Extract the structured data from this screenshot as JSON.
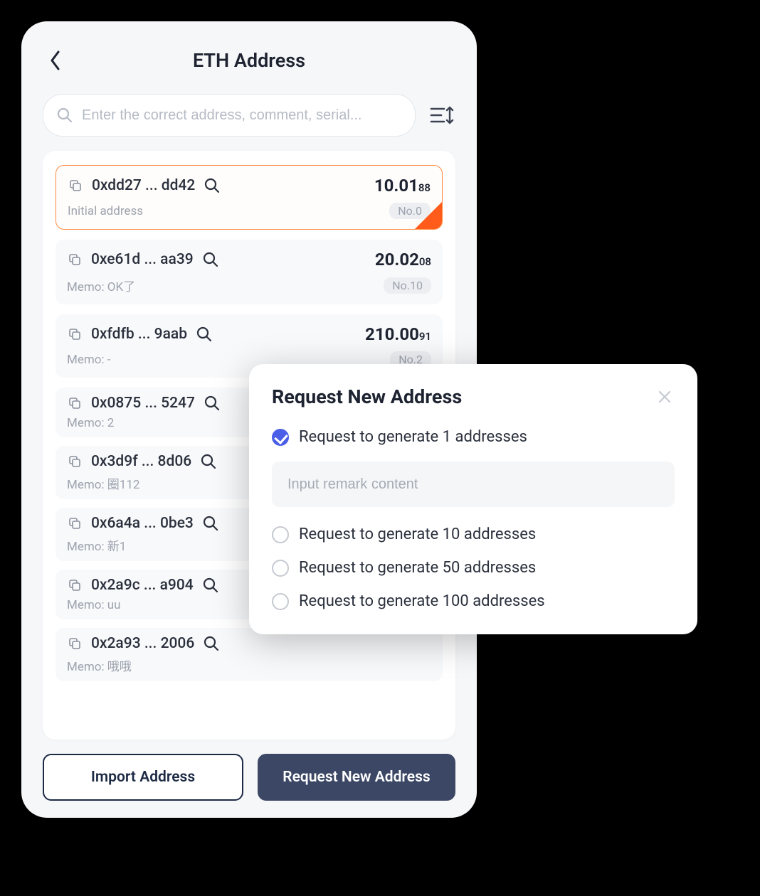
{
  "header": {
    "title": "ETH Address"
  },
  "search": {
    "placeholder": "Enter the correct address, comment, serial..."
  },
  "addresses": [
    {
      "addr": "0xdd27 ... dd42",
      "balance_int": "10.01",
      "balance_dec": "88",
      "memo": "Initial address",
      "no": "No.0",
      "selected": true
    },
    {
      "addr": "0xe61d ... aa39",
      "balance_int": "20.02",
      "balance_dec": "08",
      "memo": "Memo: OK了",
      "no": "No.10",
      "selected": false
    },
    {
      "addr": "0xfdfb ... 9aab",
      "balance_int": "210.00",
      "balance_dec": "91",
      "memo": "Memo: -",
      "no": "No.2",
      "selected": false
    },
    {
      "addr": "0x0875 ... 5247",
      "balance_int": "",
      "balance_dec": "",
      "memo": "Memo: 2",
      "no": "",
      "selected": false
    },
    {
      "addr": "0x3d9f ... 8d06",
      "balance_int": "",
      "balance_dec": "",
      "memo": "Memo: 圈112",
      "no": "",
      "selected": false
    },
    {
      "addr": "0x6a4a ... 0be3",
      "balance_int": "",
      "balance_dec": "",
      "memo": "Memo: 新1",
      "no": "",
      "selected": false
    },
    {
      "addr": "0x2a9c ... a904",
      "balance_int": "",
      "balance_dec": "",
      "memo": "Memo: uu",
      "no": "",
      "selected": false
    },
    {
      "addr": "0x2a93 ... 2006",
      "balance_int": "",
      "balance_dec": "",
      "memo": "Memo: 哦哦",
      "no": "",
      "selected": false
    }
  ],
  "buttons": {
    "import": "Import Address",
    "request": "Request New Address"
  },
  "modal": {
    "title": "Request New Address",
    "remark_placeholder": "Input remark content",
    "options": [
      {
        "label": "Request to generate 1 addresses",
        "checked": true
      },
      {
        "label": "Request to generate 10 addresses",
        "checked": false
      },
      {
        "label": "Request to generate 50 addresses",
        "checked": false
      },
      {
        "label": "Request to generate 100 addresses",
        "checked": false
      }
    ]
  }
}
